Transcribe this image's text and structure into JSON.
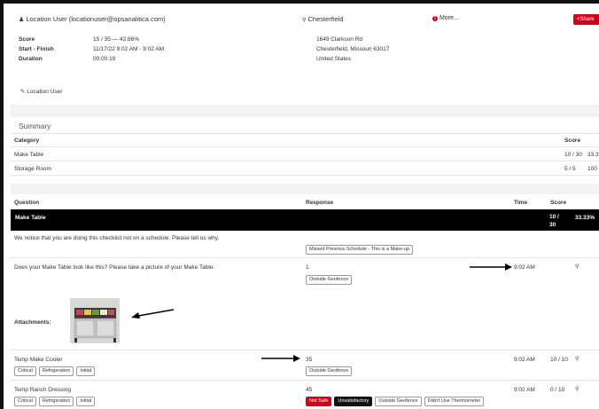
{
  "header": {
    "user_label": "Location User (locationuser@opsanalitica.com)",
    "location_name": "Chesterfield",
    "more_label": "More...",
    "share_label": "Share"
  },
  "details": {
    "score_label": "Score",
    "score_value": "15 / 35 — 42.86%",
    "start_finish_label": "Start - Finish",
    "start_finish_value": "11/17/22 9:02 AM - 9:02 AM",
    "duration_label": "Duration",
    "duration_value": "00:00:19"
  },
  "address": {
    "line1": "1649 Clarkson Rd",
    "line2": "Chesterfield, Missouri 63017",
    "line3": "United States"
  },
  "signature": {
    "label": "Location User"
  },
  "summary": {
    "title": "Summary",
    "col_category": "Category",
    "col_score": "Score",
    "rows": [
      {
        "category": "Make Table",
        "score": "10 / 30",
        "percent": "33.3"
      },
      {
        "category": "Storage Room",
        "score": "5 / 5",
        "percent": "100"
      }
    ]
  },
  "questions": {
    "col_question": "Question",
    "col_response": "Response",
    "col_time": "Time",
    "col_score": "Score",
    "section": {
      "title": "Make Table",
      "score_line1": "10 /",
      "score_line2": "30",
      "percent": "33.33%"
    },
    "q1": {
      "text": "We notice that you are doing this checklist not on a schedule. Please tell us why.",
      "response_tag": "Missed Previous Schedule - This is a Make-up"
    },
    "q2": {
      "text": "Does your Make Table look like this? Please take a picture of your Make Table.",
      "response": "1",
      "response_tag": "Outside Geofence",
      "time": "9:02 AM",
      "attachments_label": "Attachments:"
    },
    "q3": {
      "text": "Temp Make Cooler",
      "tags": [
        "Critical",
        "Refrigeration",
        "Initial"
      ],
      "response": "35",
      "response_tag": "Outside Geofence",
      "time": "9:02 AM",
      "score": "10 / 10"
    },
    "q4": {
      "text": "Temp Ranch Dressing",
      "tags": [
        "Critical",
        "Refrigeration",
        "Initial"
      ],
      "response": "45",
      "response_tags": [
        "Not Safe",
        "Unsatisfactory",
        "Outside Geofence",
        "Didn't Use Thermometer"
      ],
      "time": "9:02 AM",
      "score": "0 / 10"
    }
  },
  "colors": {
    "accent_red": "#d0021b",
    "section_black": "#000000",
    "band_gray": "#f3f3f3"
  }
}
